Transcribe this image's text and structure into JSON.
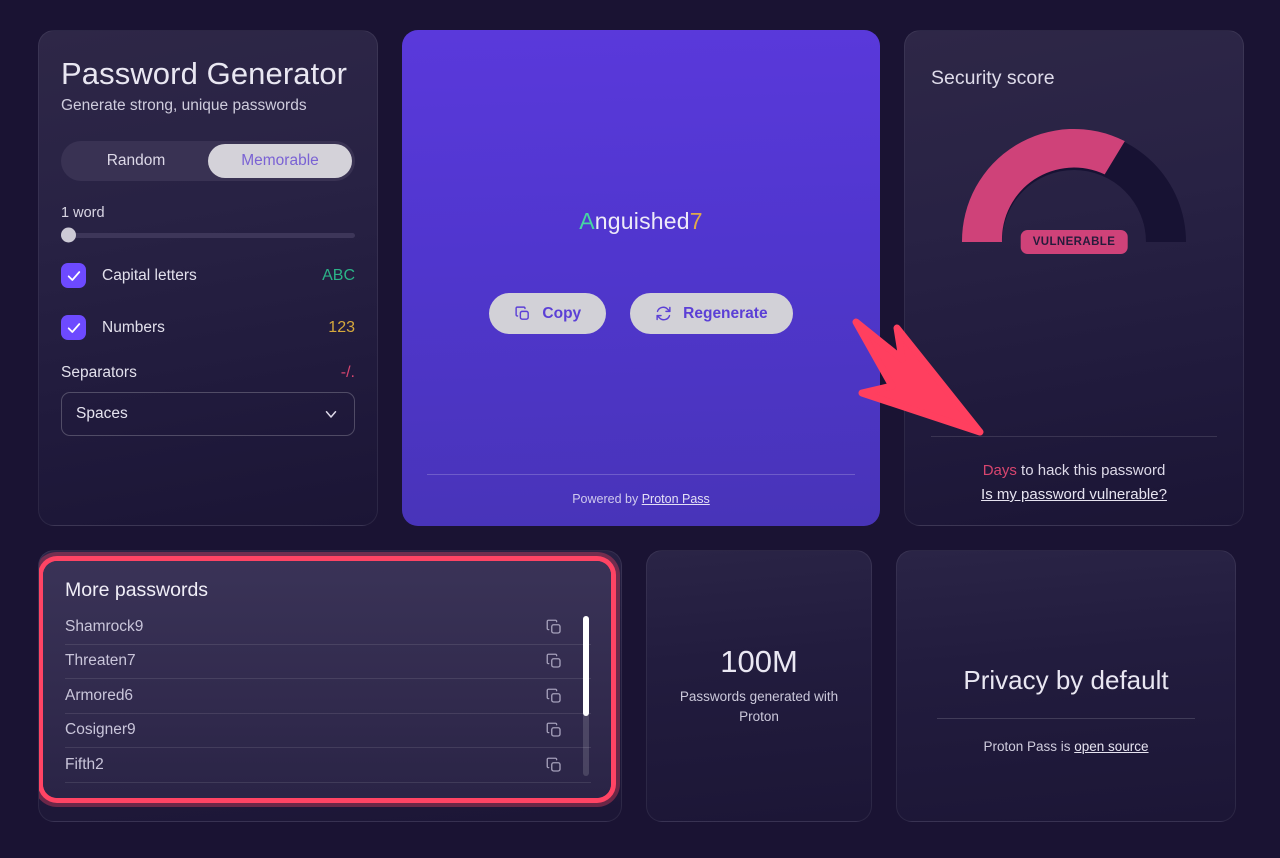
{
  "generator": {
    "title": "Password Generator",
    "subtitle": "Generate strong, unique passwords",
    "modes": [
      {
        "label": "Random",
        "active": false
      },
      {
        "label": "Memorable",
        "active": true
      }
    ],
    "slider": {
      "label": "1 word",
      "value": 1,
      "min": 1,
      "max": 10
    },
    "options": [
      {
        "label": "Capital letters",
        "hint": "ABC",
        "checked": true,
        "hint_color": "#2bb387"
      },
      {
        "label": "Numbers",
        "hint": "123",
        "checked": true,
        "hint_color": "#d6a93c"
      }
    ],
    "separators": {
      "label": "Separators",
      "hint": "-/.",
      "hint_color": "#d8456f",
      "selected": "Spaces"
    }
  },
  "display": {
    "password": "Anguished7",
    "password_parts": [
      {
        "text": "A",
        "color": "#46d6a2",
        "kind": "uppercase"
      },
      {
        "text": "nguished",
        "color": "#edeaf8",
        "kind": "letters"
      },
      {
        "text": "7",
        "color": "#e0a94b",
        "kind": "digit"
      }
    ],
    "copy_label": "Copy",
    "regenerate_label": "Regenerate",
    "powered_prefix": "Powered by ",
    "powered_link": "Proton Pass"
  },
  "security": {
    "title": "Security score",
    "badge": "VULNERABLE",
    "days_word": "Days",
    "days_rest": " to hack this password",
    "link": "Is my password vulnerable?",
    "accent_color": "#d8456f"
  },
  "more_passwords": {
    "title": "More passwords",
    "items": [
      {
        "password": "Shamrock9"
      },
      {
        "password": "Threaten7"
      },
      {
        "password": "Armored6"
      },
      {
        "password": "Cosigner9"
      },
      {
        "password": "Fifth2"
      }
    ]
  },
  "stat": {
    "number": "100M",
    "caption": "Passwords generated with Proton"
  },
  "privacy": {
    "title": "Privacy by default",
    "sub_prefix": "Proton Pass is ",
    "sub_link": "open source"
  },
  "chart_data": {
    "type": "gauge",
    "title": "Security score",
    "value": 65,
    "min": 0,
    "max": 100,
    "label": "VULNERABLE",
    "filled_color": "#cf4279",
    "track_color": "#171233",
    "start_angle": 180,
    "end_angle": 0
  },
  "annotations": {
    "arrow": {
      "color": "#ff3f5f",
      "points_to": "Days to hack this password"
    },
    "highlight_box": {
      "color": "#ff4464",
      "target": "More passwords"
    }
  }
}
